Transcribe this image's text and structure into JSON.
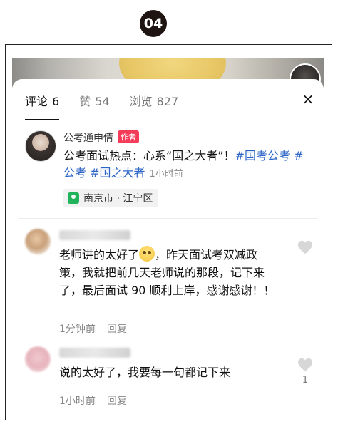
{
  "step_badge": "04",
  "tabs": [
    {
      "label": "评论",
      "count": "6"
    },
    {
      "label": "赞",
      "count": "54"
    },
    {
      "label": "浏览",
      "count": "827"
    }
  ],
  "close_label": "×",
  "post": {
    "author": "公考通申倩",
    "author_tag": "作者",
    "text": "公考面试热点：心系“国之大者”！",
    "hashtags": [
      "#国考公考",
      "#公考",
      "#国之大者"
    ],
    "time": "1小时前",
    "location": "南京市 · 江宁区"
  },
  "comments": [
    {
      "text_before": "老师讲的太好了",
      "text_after": "，昨天面试考双减政策，我就把前几天老师说的那段，记下来了，最后面试 90 顺利上岸，感谢感谢！！",
      "time": "1分钟前",
      "reply_label": "回复",
      "likes": ""
    },
    {
      "text_before": "说的太好了，我要每一句都记下来",
      "text_after": "",
      "time": "1小时前",
      "reply_label": "回复",
      "likes": "1"
    }
  ],
  "colors": {
    "hashtag": "#2c64c7",
    "author_tag": "#f43b58",
    "location_icon": "#20b35b"
  }
}
